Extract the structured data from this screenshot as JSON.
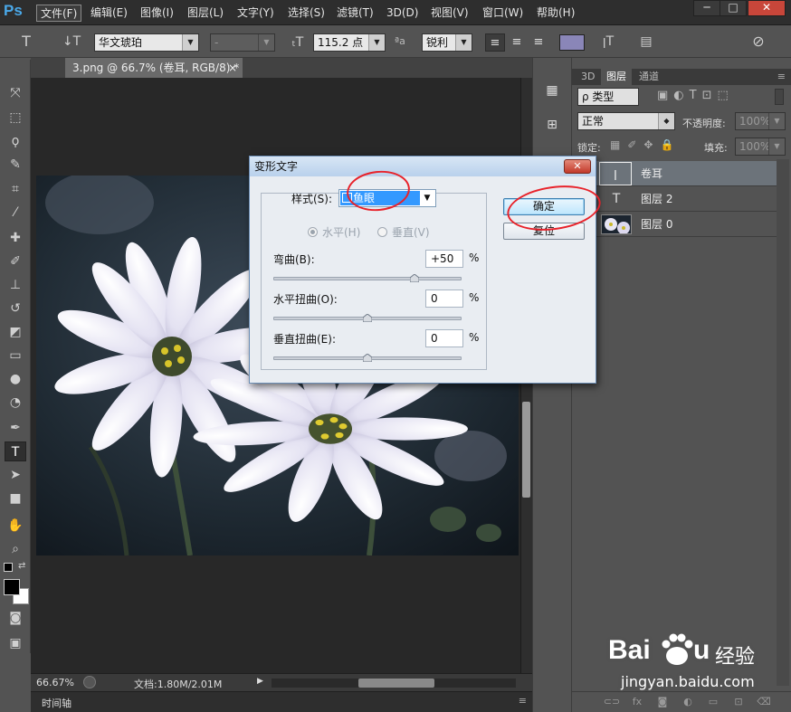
{
  "app": {
    "logo": "Ps"
  },
  "menu": [
    "文件(F)",
    "编辑(E)",
    "图像(I)",
    "图层(L)",
    "文字(Y)",
    "选择(S)",
    "滤镜(T)",
    "3D(D)",
    "视图(V)",
    "窗口(W)",
    "帮助(H)"
  ],
  "window_controls": {
    "minimize": "─",
    "maximize": "□",
    "close": "✕"
  },
  "options": {
    "font_family": "华文琥珀",
    "font_style": "-",
    "font_size": "115.2 点",
    "aa_label": "ªa",
    "anti_alias": "锐利",
    "text_color": "#8a86b8"
  },
  "document": {
    "tab_title": "3.png @ 66.7% (卷耳, RGB/8) *",
    "close": "×"
  },
  "status": {
    "zoom": "66.67%",
    "doc_size": "文档:1.80M/2.01M",
    "arrow": "▶"
  },
  "timeline": {
    "label": "时间轴"
  },
  "dialog": {
    "title": "变形文字",
    "close": "✕",
    "style_label": "样式(S):",
    "style_value": "鱼眼",
    "horizontal": "水平(H)",
    "vertical": "垂直(V)",
    "bend_label": "弯曲(B):",
    "bend_value": "+50",
    "bend_fraction": 0.75,
    "hdist_label": "水平扭曲(O):",
    "hdist_value": "0",
    "hdist_fraction": 0.5,
    "vdist_label": "垂直扭曲(E):",
    "vdist_value": "0",
    "vdist_fraction": 0.5,
    "percent": "%",
    "ok": "确定",
    "reset": "复位"
  },
  "layers_panel": {
    "tabs": [
      "3D",
      "图层",
      "通道"
    ],
    "filter_kind": "ρ 类型",
    "blend_mode": "正常",
    "opacity_label": "不透明度:",
    "opacity_value": "100%",
    "lock_label": "锁定:",
    "fill_label": "填充:",
    "fill_value": "100%",
    "layers": [
      {
        "name": "卷耳",
        "kind": "warped-text"
      },
      {
        "name": "图层 2",
        "kind": "text"
      },
      {
        "name": "图层 0",
        "kind": "image"
      }
    ]
  },
  "colors": {
    "accent": "#3399ff",
    "annotation": "#e8222a",
    "selected_layer": "#6c737a"
  },
  "watermark": {
    "brand": "Bai",
    "brand_end": "u",
    "site_cn": "经验",
    "url": "jingyan.baidu.com"
  }
}
